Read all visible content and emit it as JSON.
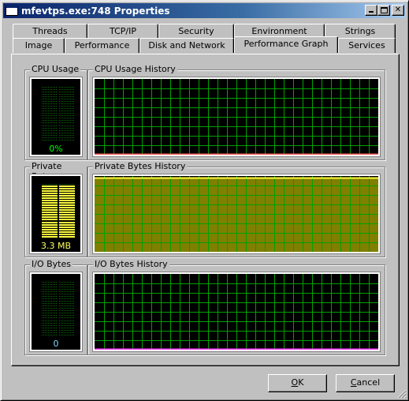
{
  "window": {
    "title": "mfevtps.exe:748 Properties",
    "controls": [
      "minimize",
      "maximize",
      "close"
    ]
  },
  "tabs": {
    "row_back": [
      {
        "label": "Threads"
      },
      {
        "label": "TCP/IP"
      },
      {
        "label": "Security"
      },
      {
        "label": "Environment"
      },
      {
        "label": "Strings"
      }
    ],
    "row_front": [
      {
        "label": "Image"
      },
      {
        "label": "Performance"
      },
      {
        "label": "Disk and Network"
      },
      {
        "label": "Performance Graph",
        "active": true
      },
      {
        "label": "Services"
      }
    ]
  },
  "graphs": {
    "cpu": {
      "meter_label": "CPU Usage",
      "meter_value": "0%",
      "meter_fill": 0,
      "meter_color": "#00ff00",
      "meter_idle_color": "#0a6e0a",
      "value_color": "#00ff00",
      "history_label": "CPU Usage History",
      "history_fill": 0,
      "baseline_color": "#ff6060",
      "fill_color": "#000000"
    },
    "private": {
      "meter_label": "Private Bytes",
      "meter_value": "3.3 MB",
      "meter_fill": 0.97,
      "meter_color": "#ffff40",
      "meter_idle_color": "#0a6e0a",
      "value_color": "#ffff60",
      "history_label": "Private Bytes History",
      "history_fill": 0.97,
      "baseline_color": "#ffff40",
      "fill_color": "#808000"
    },
    "io": {
      "meter_label": "I/O Bytes",
      "meter_value": "0",
      "meter_fill": 0,
      "meter_color": "#00ff00",
      "meter_idle_color": "#0a6e0a",
      "value_color": "#80d8ff",
      "history_label": "I/O Bytes History",
      "history_fill": 0,
      "baseline_color": "#ff40ff",
      "fill_color": "#000000"
    }
  },
  "colors": {
    "grid": "#00a000",
    "title_start": "#0a246a",
    "title_end": "#a6caf0"
  },
  "buttons": {
    "ok": {
      "label": "OK",
      "mnemonic": "O",
      "rest": "K"
    },
    "cancel": {
      "label": "Cancel",
      "mnemonic": "C",
      "rest": "ancel"
    }
  }
}
